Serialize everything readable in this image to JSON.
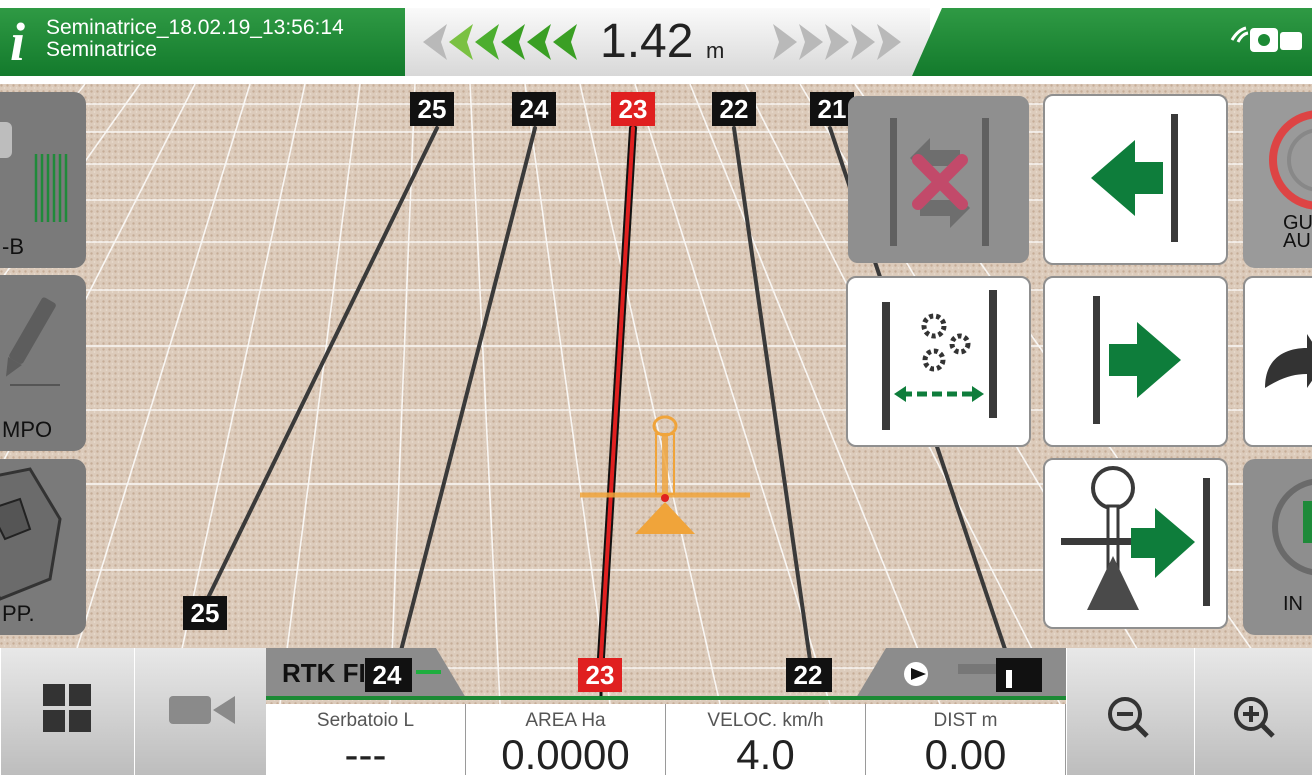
{
  "header": {
    "info_icon": "i",
    "session_name": "Seminatrice_18.02.19_13:56:14",
    "implement_name": "Seminatrice",
    "deviation_value": "1.42",
    "deviation_unit": "m",
    "gps_icon": "satellite-signal-icon"
  },
  "line_labels_top": [
    "25",
    "24",
    "23",
    "22",
    "21"
  ],
  "line_labels_bottom": [
    "25",
    "24",
    "23",
    "22"
  ],
  "left_panel": {
    "ab_label": "-B",
    "field_label": "MPO",
    "map_label": "PP."
  },
  "right_panel": {
    "guide_label_1": "GU",
    "guide_label_2": "AU",
    "info_label": "IN"
  },
  "bottom_bar": {
    "gnss_status": "RTK FIX",
    "cells": [
      {
        "label": "Serbatoio L",
        "value": "---"
      },
      {
        "label": "AREA Ha",
        "value": "0.0000"
      },
      {
        "label": "VELOC. km/h",
        "value": "4.0"
      },
      {
        "label": "DIST m",
        "value": "0.00"
      }
    ]
  },
  "colors": {
    "header_green": "#1c8a35",
    "arrow_green": "#0e7d3b",
    "active_line_red": "#e02020",
    "implement_orange": "#f0a43a"
  }
}
